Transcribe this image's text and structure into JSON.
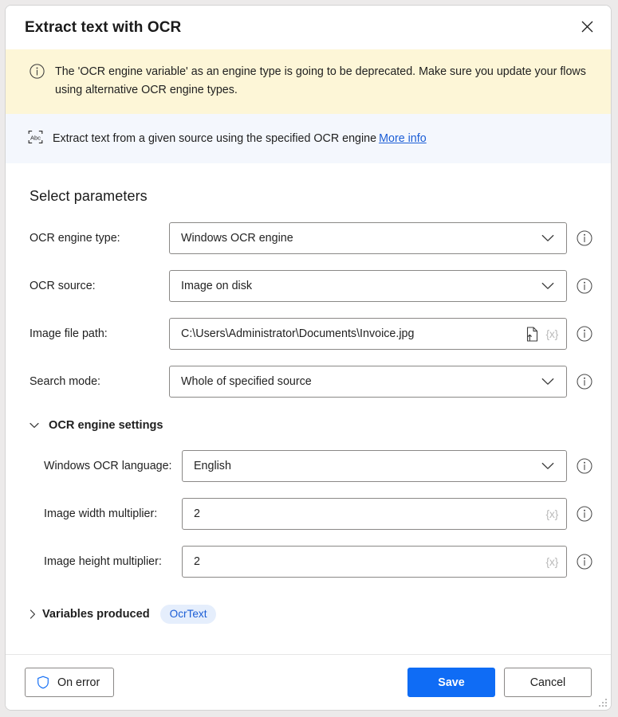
{
  "window": {
    "title": "Extract text with OCR",
    "close_label": "✕"
  },
  "warning": {
    "icon": "info-circle-icon",
    "text": "The 'OCR engine variable' as an engine type is going to be deprecated.  Make sure you update your flows using alternative OCR engine types."
  },
  "description": {
    "icon": "ocr-abc-icon",
    "text": "Extract text from a given source using the specified OCR engine",
    "link_label": "More info"
  },
  "parameters": {
    "heading": "Select parameters",
    "fields": [
      {
        "label": "OCR engine type:",
        "value": "Windows OCR engine",
        "type": "dropdown",
        "indented": false
      },
      {
        "label": "OCR source:",
        "value": "Image on disk",
        "type": "dropdown",
        "indented": false
      },
      {
        "label": "Image file path:",
        "value": "C:\\Users\\Administrator\\Documents\\Invoice.jpg",
        "type": "file",
        "var_token": "{x}",
        "indented": false
      },
      {
        "label": "Search mode:",
        "value": "Whole of specified source",
        "type": "dropdown",
        "indented": false
      }
    ]
  },
  "engine_settings": {
    "title": "OCR engine settings",
    "expanded": true,
    "fields": [
      {
        "label": "Windows OCR language:",
        "value": "English",
        "type": "dropdown",
        "indented": true
      },
      {
        "label": "Image width multiplier:",
        "value": "2",
        "type": "text",
        "var_token": "{x}",
        "indented": true
      },
      {
        "label": "Image height multiplier:",
        "value": "2",
        "type": "text",
        "var_token": "{x}",
        "indented": true
      }
    ]
  },
  "variables_produced": {
    "label": "Variables produced",
    "expanded": false,
    "pill": "OcrText"
  },
  "footer": {
    "on_error_label": "On error",
    "save_label": "Save",
    "cancel_label": "Cancel"
  },
  "colors": {
    "accent": "#0f6cf5",
    "warning_bg": "#fdf6d7",
    "info_bg": "#f4f7fd",
    "link": "#1c5ed6",
    "pill_bg": "#e5eefc"
  }
}
